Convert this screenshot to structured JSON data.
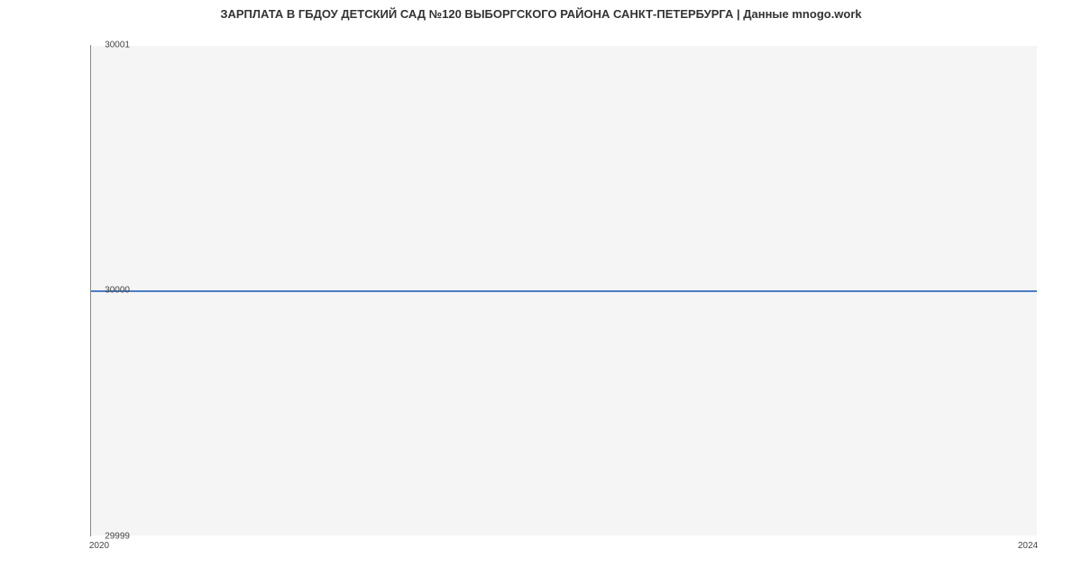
{
  "chart_data": {
    "type": "line",
    "title": "ЗАРПЛАТА В ГБДОУ ДЕТСКИЙ САД №120 ВЫБОРГСКОГО РАЙОНА САНКТ-ПЕТЕРБУРГА | Данные mnogo.work",
    "x": [
      2020,
      2024
    ],
    "values": [
      30000,
      30000
    ],
    "xlabel": "",
    "ylabel": "",
    "ylim": [
      29999,
      30001
    ],
    "xlim": [
      2020,
      2024
    ],
    "y_ticks": [
      "29999",
      "30000",
      "30001"
    ],
    "x_ticks": [
      "2020",
      "2024"
    ],
    "line_color": "#4a7fc8"
  }
}
